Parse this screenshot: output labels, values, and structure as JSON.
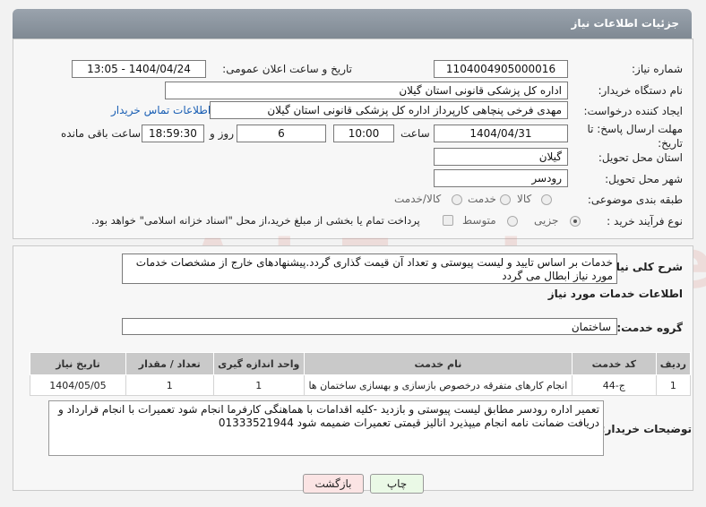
{
  "header": {
    "title": "جزئیات اطلاعات نیاز"
  },
  "fields": {
    "need_number_label": "شماره نیاز:",
    "need_number": "1104004905000016",
    "announce_label": "تاریخ و ساعت اعلان عمومی:",
    "announce_value": "1404/04/24 - 13:05",
    "buyer_org_label": "نام دستگاه خریدار:",
    "buyer_org": "اداره کل پزشکی قانونی استان گیلان",
    "creator_label": "ایجاد کننده درخواست:",
    "creator": "مهدی فرخی پنچاهی کارپرداز  اداره کل پزشکی قانونی استان گیلان",
    "contact_link": "اطلاعات تماس خریدار",
    "deadline_label_1": "مهلت ارسال پاسخ: تا",
    "deadline_label_2": "تاریخ:",
    "deadline_date": "1404/04/31",
    "time_label": "ساعت",
    "deadline_time": "10:00",
    "days_value": "6",
    "days_label": "روز و",
    "remaining_time": "18:59:30",
    "remaining_label": "ساعت باقی مانده",
    "province_label": "استان محل تحویل:",
    "province": "گیلان",
    "city_label": "شهر محل تحویل:",
    "city": "رودسر",
    "category_label": "طبقه بندی موضوعی:",
    "category_options": [
      "کالا",
      "خدمت",
      "کالا/خدمت"
    ],
    "purchase_type_label": "نوع فرآیند خرید :",
    "purchase_options": [
      "جزیی",
      "متوسط"
    ],
    "payment_note": "پرداخت تمام یا بخشی از مبلغ خرید،از محل \"اسناد خزانه اسلامی\" خواهد بود."
  },
  "summary": {
    "label": "شرح کلی نیاز:",
    "text": "خدمات  بر اساس تایید و لیست پیوستی و تعداد آن قیمت گذاری گردد.پیشنهادهای خارج از مشخصات خدمات مورد نیاز ابطال می گردد"
  },
  "services": {
    "section_title": "اطلاعات خدمات مورد نیاز",
    "group_label": "گروه خدمت:",
    "group_value": "ساختمان",
    "columns": [
      "ردیف",
      "کد خدمت",
      "نام خدمت",
      "واحد اندازه گیری",
      "تعداد / مقدار",
      "تاریخ نیاز"
    ],
    "rows": [
      [
        "1",
        "ج-44",
        "انجام کارهای متفرقه درخصوص بازسازی و بهسازی ساختمان ها",
        "1",
        "1",
        "1404/05/05"
      ]
    ]
  },
  "buyer_notes": {
    "label": "توضیحات خریدار:",
    "text": "تعمیر اداره رودسر مطابق لیست پیوستی و بازدید -کلیه اقدامات با هماهنگی کارفرما انجام شود  تعمیرات با انجام قرارداد و دریافت ضمانت نامه انجام میپذیرد  انالیز قیمتی تعمیرات ضمیمه شود 01333521944"
  },
  "buttons": {
    "print": "چاپ",
    "back": "بازگشت"
  },
  "watermark": {
    "text": "AriaTender.neT"
  },
  "colors": {
    "header_bg": "#8a939d",
    "link": "#1a5fb4",
    "print_bg": "#eaf9e6",
    "back_bg": "#fbe4e4"
  }
}
